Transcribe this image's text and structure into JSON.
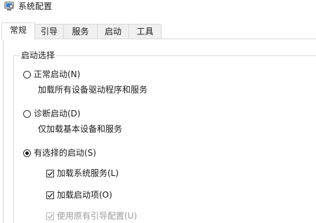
{
  "window": {
    "title": "系统配置",
    "icon": "system-configuration-icon"
  },
  "tabs": [
    {
      "label": "常规",
      "active": true
    },
    {
      "label": "引导",
      "active": false
    },
    {
      "label": "服务",
      "active": false
    },
    {
      "label": "启动",
      "active": false
    },
    {
      "label": "工具",
      "active": false
    }
  ],
  "startup_selection": {
    "legend": "启动选择",
    "normal": {
      "label": "正常启动(N)",
      "description": "加载所有设备驱动程序和服务",
      "selected": false
    },
    "diagnostic": {
      "label": "诊断启动(D)",
      "description": "仅加载基本设备和服务",
      "selected": false
    },
    "selective": {
      "label": "有选择的启动(S)",
      "selected": true,
      "options": {
        "load_services": {
          "label": "加载系统服务(L)",
          "checked": true,
          "enabled": true
        },
        "load_startup_items": {
          "label": "加载启动项(O)",
          "checked": true,
          "enabled": true
        },
        "use_original_boot_config": {
          "label": "使用原有引导配置(U)",
          "checked": true,
          "enabled": false
        }
      }
    }
  }
}
